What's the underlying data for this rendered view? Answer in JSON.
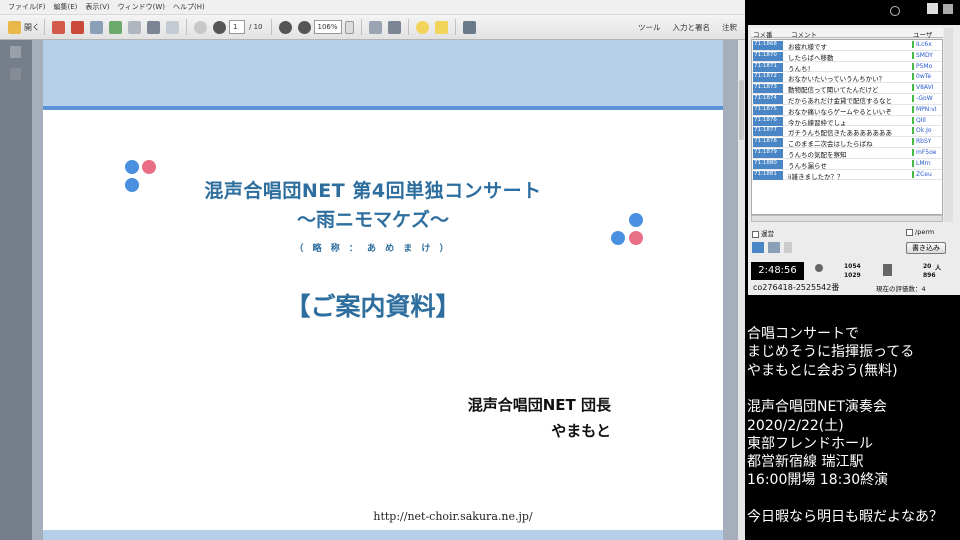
{
  "viewer": {
    "menu": [
      "ファイル(F)",
      "編集(E)",
      "表示(V)",
      "ウィンドウ(W)",
      "ヘルプ(H)"
    ],
    "toolbar": {
      "open_label": "開く",
      "page_current": "1",
      "page_total": "/ 10",
      "zoom": "106%",
      "tools_label": "ツール",
      "sign_label": "入力と署名",
      "comment_label": "注釈"
    }
  },
  "document": {
    "title": "混声合唱団NET 第4回単独コンサート",
    "subtitle": "～雨ニモマケズ～",
    "abbreviation": "（ 略 称 ： あ め ま け ）",
    "guide_heading": "【ご案内資料】",
    "organization": "混声合唱団NET 団長",
    "leader_name": "やまもと",
    "url": "http://net-choir.sakura.ne.jp/"
  },
  "comments_panel": {
    "col_no": "コメ番",
    "col_comment": "コメント",
    "col_user": "ユーザ",
    "rows": [
      {
        "no": "71:1868",
        "text": "お疲れ様です",
        "user": "ILc6x"
      },
      {
        "no": "71:1870",
        "text": "したらばへ移動",
        "user": "SMDY"
      },
      {
        "no": "71:1871",
        "text": "うんち！",
        "user": "P5Mo"
      },
      {
        "no": "71:1872",
        "text": "おなかいたいっていうんちかい？",
        "user": "0wTe"
      },
      {
        "no": "71:1873",
        "text": "動物配信って聞いてたんだけど",
        "user": "V8AVI"
      },
      {
        "no": "71:1874",
        "text": "だからあれだけ金貸で配信するなと",
        "user": "-GoW"
      },
      {
        "no": "71:1875",
        "text": "おなか痛いならゲームやるといいぞ",
        "user": "MPN:vI"
      },
      {
        "no": "71:1876",
        "text": "今から練習枠でしょ",
        "user": "QlIl"
      },
      {
        "no": "71:1877",
        "text": "ガチうんち配信きたあああああああ",
        "user": "Ok.Jo"
      },
      {
        "no": "71:1878",
        "text": "このまま二次会はしたらばね",
        "user": "RbSY"
      },
      {
        "no": "71:1879",
        "text": "うんちの気配を察知",
        "user": "mF5oe"
      },
      {
        "no": "71:1880",
        "text": "うんち漏らせ",
        "user": "LMrn"
      },
      {
        "no": "71:1881",
        "text": "ii雑きましたか？？",
        "user": "ZCeu"
      }
    ],
    "admin_label": "運営",
    "perm_label": "/perm",
    "write_button": "書き込み",
    "timer": "2:48:56",
    "visitors": "1054",
    "comments_count": "1029",
    "ad_count": "20",
    "ad_unit": "人",
    "points": "896",
    "live_id": "co276418-2525542番",
    "rank_label": "現在の評価数：4"
  },
  "overlay": {
    "lines": [
      "合唱コンサートで",
      "まじめそうに指揮振ってる",
      "やまもとに会おう(無料)",
      "",
      "混声合唱団NET演奏会",
      "2020/2/22(土)",
      "東部フレンドホール",
      "都営新宿線 瑞江駅",
      "16:00開場 18:30終演",
      "",
      "今日暇なら明日も暇だよなあ？"
    ]
  }
}
